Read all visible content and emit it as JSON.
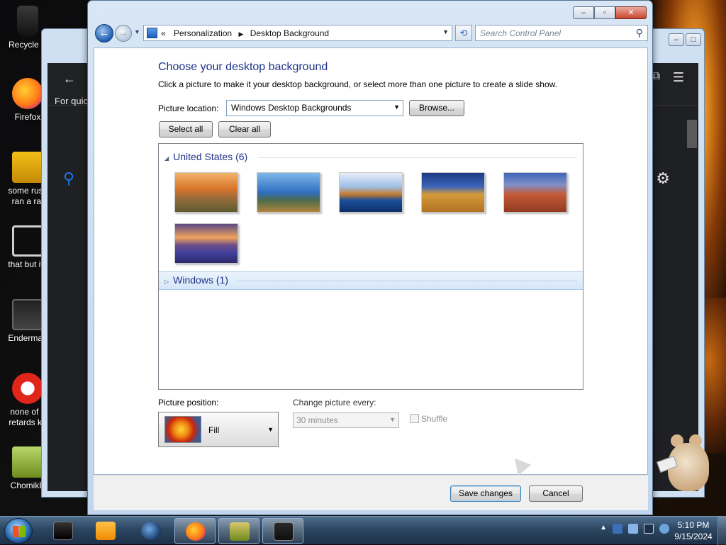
{
  "desktop": {
    "icons": [
      {
        "label_line1": "Recycle B",
        "label_line2": ""
      },
      {
        "label_line1": "Firefox",
        "label_line2": ""
      },
      {
        "label_line1": "some russ",
        "label_line2": "ran a rat"
      },
      {
        "label_line1": "that but its",
        "label_line2": ""
      },
      {
        "label_line1": "Enderman",
        "label_line2": ""
      },
      {
        "label_line1": "none of y",
        "label_line2": "retards kn"
      },
      {
        "label_line1": "ChomikB",
        "label_line2": ""
      }
    ]
  },
  "background_window": {
    "hint_text": "For quick"
  },
  "window": {
    "nav": {
      "breadcrumb_root_marker": "«",
      "breadcrumb": [
        "Personalization",
        "Desktop Background"
      ],
      "search_placeholder": "Search Control Panel"
    },
    "heading": "Choose your desktop background",
    "description": "Click a picture to make it your desktop background, or select more than one picture to create a slide show.",
    "picture_location": {
      "label": "Picture location:",
      "value": "Windows Desktop Backgrounds",
      "browse_label": "Browse..."
    },
    "select_all_label": "Select all",
    "clear_all_label": "Clear all",
    "groups": [
      {
        "name": "United States (6)",
        "expanded": true,
        "thumbnails": [
          {
            "name": "sunset-meadow"
          },
          {
            "name": "lighthouse-coast"
          },
          {
            "name": "sea-stack-reflection"
          },
          {
            "name": "hay-bale-field"
          },
          {
            "name": "delicate-arch"
          },
          {
            "name": "lupine-lake-dusk"
          }
        ]
      },
      {
        "name": "Windows (1)",
        "expanded": false
      }
    ],
    "picture_position": {
      "label": "Picture position:",
      "value": "Fill"
    },
    "change_picture": {
      "label": "Change picture every:",
      "value": "30 minutes",
      "shuffle_label": "Shuffle"
    },
    "save_label": "Save changes",
    "cancel_label": "Cancel"
  },
  "taskbar": {
    "time": "5:10 PM",
    "date": "9/15/2024"
  },
  "colors": {
    "heading_blue": "#1e3287",
    "selected_group": "#d6e7f9",
    "taskbar": "#2c4661"
  }
}
